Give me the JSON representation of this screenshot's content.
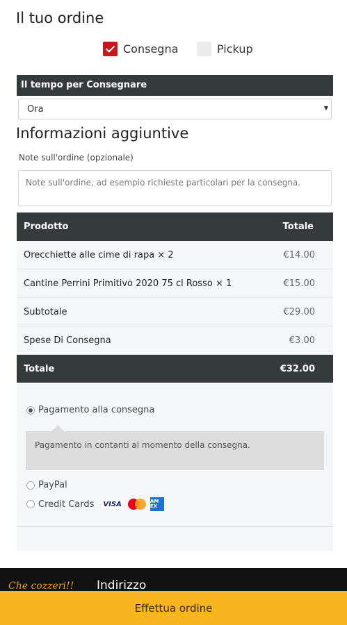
{
  "order": {
    "title": "Il tuo ordine"
  },
  "delivery_method": {
    "options": [
      {
        "label": "Consegna",
        "checked": true
      },
      {
        "label": "Pickup",
        "checked": false
      }
    ]
  },
  "delivery_time": {
    "header": "Il tempo per Consegnare",
    "selected": "Ora"
  },
  "additional_info": {
    "title": "Informazioni aggiuntive",
    "notes_label": "Note sull'ordine (opzionale)",
    "notes_placeholder": "Note sull'ordine, ad esempio richieste particolari per la consegna."
  },
  "order_table": {
    "headers": {
      "product": "Prodotto",
      "total": "Totale"
    },
    "rows": [
      {
        "product": "Orecchiette alle cime di rapa  × 2",
        "price": "€14.00"
      },
      {
        "product": "Cantine Perrini Primitivo 2020 75 cl Rosso  × 1",
        "price": "€15.00"
      },
      {
        "product": "Subtotale",
        "price": "€29.00"
      },
      {
        "product": "Spese Di Consegna",
        "price": "€3.00"
      }
    ],
    "total_label": "Totale",
    "total_value": "€32.00"
  },
  "payment": {
    "options": [
      {
        "label": "Pagamento alla consegna",
        "selected": true
      },
      {
        "label": "PayPal",
        "selected": false
      },
      {
        "label": "Credit Cards",
        "selected": false
      }
    ],
    "cod_description": "Pagamento in contanti al momento della consegna.",
    "card_brands": {
      "visa": "VISA",
      "amex": "AM EX"
    }
  },
  "footer": {
    "logo_text": "Che cozzeri!!",
    "address_label": "Indirizzo"
  },
  "place_order_label": "Effettua ordine",
  "colors": {
    "accent": "#c4161c",
    "dark_bar": "#353a3d",
    "order_button": "#f7b51f"
  }
}
